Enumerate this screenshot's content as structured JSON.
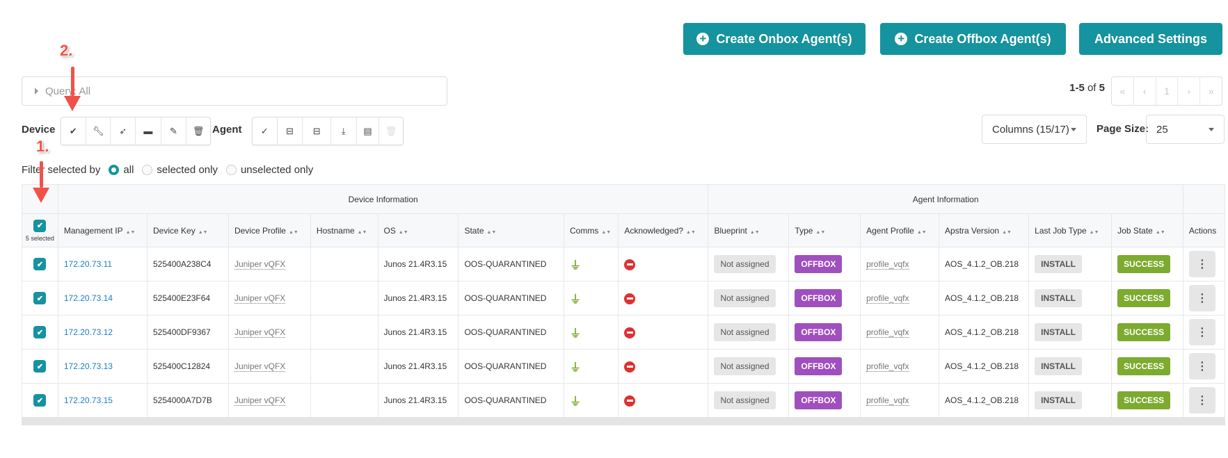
{
  "header": {
    "create_onbox": "Create Onbox Agent(s)",
    "create_offbox": "Create Offbox Agent(s)",
    "advanced_settings": "Advanced Settings"
  },
  "query": {
    "label": "Query: All"
  },
  "pagination": {
    "range": "1-5",
    "of": "of",
    "total": "5",
    "first": "«",
    "prev": "‹",
    "page": "1",
    "next": "›",
    "last": "»"
  },
  "device_toolbar": {
    "label": "Device",
    "icons": [
      "check-circle-icon",
      "wrench-icon",
      "rocket-icon",
      "archive-icon",
      "edit-icon",
      "trash-icon"
    ]
  },
  "agent_toolbar": {
    "label": "Agent",
    "icons": [
      "check-icon",
      "drive-icon",
      "drive-remove-icon",
      "download-icon",
      "file-icon",
      "trash-disabled-icon"
    ]
  },
  "columns_dropdown": "Columns (15/17)",
  "page_size": {
    "label": "Page Size:",
    "value": "25"
  },
  "filter": {
    "label": "Filter selected by",
    "options": [
      "all",
      "selected only",
      "unselected only"
    ],
    "selected": "all"
  },
  "annotations": [
    "1.",
    "2."
  ],
  "table": {
    "groups": [
      "Device Information",
      "Agent Information"
    ],
    "selected_count": "5 selected",
    "columns": [
      "Management IP",
      "Device Key",
      "Device Profile",
      "Hostname",
      "OS",
      "State",
      "Comms",
      "Acknowledged?",
      "Blueprint",
      "Type",
      "Agent Profile",
      "Apstra Version",
      "Last Job Type",
      "Job State",
      "Actions"
    ],
    "rows": [
      {
        "ip": "172.20.73.11",
        "key": "525400A238C4",
        "profile": "Juniper vQFX",
        "hostname": "",
        "os": "Junos 21.4R3.15",
        "state": "OOS-QUARANTINED",
        "blueprint": "Not assigned",
        "type": "OFFBOX",
        "agent_profile": "profile_vqfx",
        "version": "AOS_4.1.2_OB.218",
        "job_type": "INSTALL",
        "job_state": "SUCCESS"
      },
      {
        "ip": "172.20.73.14",
        "key": "525400E23F64",
        "profile": "Juniper vQFX",
        "hostname": "",
        "os": "Junos 21.4R3.15",
        "state": "OOS-QUARANTINED",
        "blueprint": "Not assigned",
        "type": "OFFBOX",
        "agent_profile": "profile_vqfx",
        "version": "AOS_4.1.2_OB.218",
        "job_type": "INSTALL",
        "job_state": "SUCCESS"
      },
      {
        "ip": "172.20.73.12",
        "key": "525400DF9367",
        "profile": "Juniper vQFX",
        "hostname": "",
        "os": "Junos 21.4R3.15",
        "state": "OOS-QUARANTINED",
        "blueprint": "Not assigned",
        "type": "OFFBOX",
        "agent_profile": "profile_vqfx",
        "version": "AOS_4.1.2_OB.218",
        "job_type": "INSTALL",
        "job_state": "SUCCESS"
      },
      {
        "ip": "172.20.73.13",
        "key": "525400C12824",
        "profile": "Juniper vQFX",
        "hostname": "",
        "os": "Junos 21.4R3.15",
        "state": "OOS-QUARANTINED",
        "blueprint": "Not assigned",
        "type": "OFFBOX",
        "agent_profile": "profile_vqfx",
        "version": "AOS_4.1.2_OB.218",
        "job_type": "INSTALL",
        "job_state": "SUCCESS"
      },
      {
        "ip": "172.20.73.15",
        "key": "5254000A7D7B",
        "profile": "Juniper vQFX",
        "hostname": "",
        "os": "Junos 21.4R3.15",
        "state": "OOS-QUARANTINED",
        "blueprint": "Not assigned",
        "type": "OFFBOX",
        "agent_profile": "profile_vqfx",
        "version": "AOS_4.1.2_OB.218",
        "job_type": "INSTALL",
        "job_state": "SUCCESS"
      }
    ]
  },
  "colors": {
    "accent": "#15939e",
    "offbox": "#a04fbf",
    "success": "#7cab2f",
    "annotation": "#f0524a"
  }
}
